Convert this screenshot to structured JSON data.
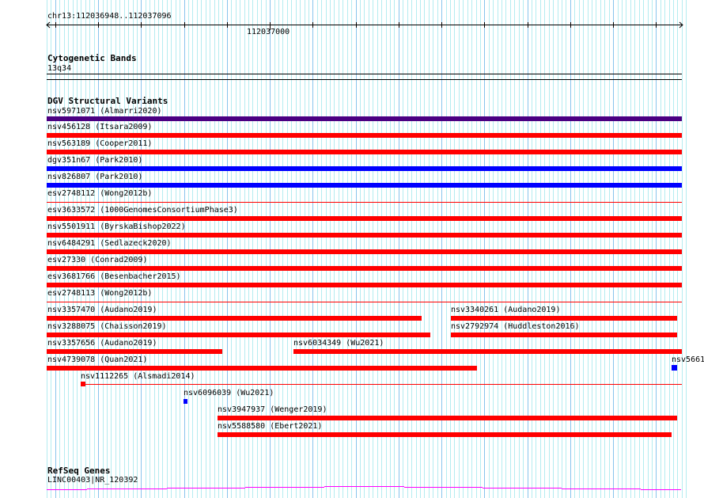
{
  "ruler": {
    "location": "chr13:112036948..112037096",
    "tick_label": "112037000",
    "start": 112036948,
    "end": 112037096
  },
  "colors": {
    "grid_minor": "#b4ecf0",
    "grid_major": "#88c4ec",
    "red": "#ff0000",
    "blue": "#0000ff",
    "purple": "#4b0082",
    "magenta": "#ff00ff"
  },
  "cytoband": {
    "title": "Cytogenetic Bands",
    "band": "13q34"
  },
  "dgv": {
    "title": "DGV Structural Variants",
    "features": [
      {
        "label": "nsv5971071 (Almarri2020)",
        "color": "purple"
      },
      {
        "label": "nsv456128 (Itsara2009)",
        "color": "red"
      },
      {
        "label": "nsv563189 (Cooper2011)",
        "color": "red"
      },
      {
        "label": "dgv351n67 (Park2010)",
        "color": "blue"
      },
      {
        "label": "nsv826807 (Park2010)",
        "color": "blue"
      },
      {
        "label": "esv2748112 (Wong2012b)",
        "color": "red"
      },
      {
        "label": "esv3633572 (1000GenomesConsortiumPhase3)",
        "color": "red"
      },
      {
        "label": "nsv5501911 (ByrskaBishop2022)",
        "color": "red"
      },
      {
        "label": "nsv6484291 (Sedlazeck2020)",
        "color": "red"
      },
      {
        "label": "esv27330 (Conrad2009)",
        "color": "red"
      },
      {
        "label": "esv3681766 (Besenbacher2015)",
        "color": "red"
      },
      {
        "label": "esv2748113 (Wong2012b)",
        "color": "red"
      },
      {
        "label": "nsv3357470 (Audano2019)",
        "color": "red"
      },
      {
        "label": "nsv3340261 (Audano2019)",
        "color": "red"
      },
      {
        "label": "nsv3288075 (Chaisson2019)",
        "color": "red"
      },
      {
        "label": "nsv2792974 (Huddleston2016)",
        "color": "red"
      },
      {
        "label": "nsv3357656 (Audano2019)",
        "color": "red"
      },
      {
        "label": "nsv6034349 (Wu2021)",
        "color": "red"
      },
      {
        "label": "nsv4739078 (Quan2021)",
        "color": "red"
      },
      {
        "label": "nsv5661",
        "color": "blue"
      },
      {
        "label": "nsv1112265 (Alsmadi2014)",
        "color": "red"
      },
      {
        "label": "nsv6096039 (Wu2021)",
        "color": "blue"
      },
      {
        "label": "nsv3947937 (Wenger2019)",
        "color": "red"
      },
      {
        "label": "nsv5588580 (Ebert2021)",
        "color": "red"
      }
    ]
  },
  "refseq": {
    "title": "RefSeq Genes",
    "gene": "LINC00403|NR_120392"
  }
}
